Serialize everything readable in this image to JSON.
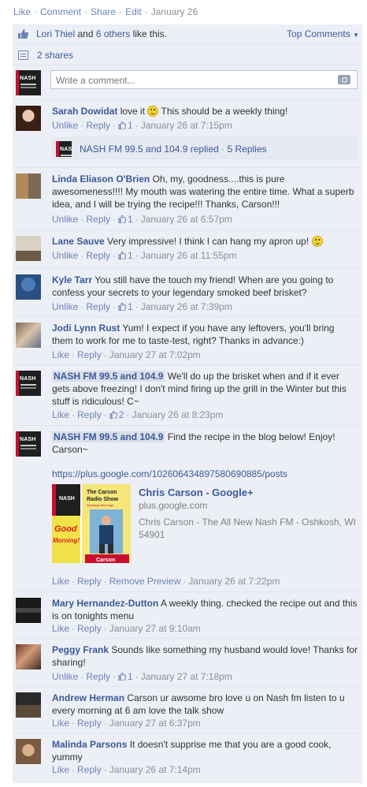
{
  "topbar": {
    "like": "Like",
    "comment": "Comment",
    "share": "Share",
    "edit": "Edit",
    "date": "January 26"
  },
  "likes": {
    "name": "Lori Thiel",
    "and": "and",
    "others": "6 others",
    "suffix": "like this.",
    "top_comments": "Top Comments"
  },
  "shares": {
    "label": "2 shares"
  },
  "write": {
    "placeholder": "Write a comment..."
  },
  "colors": {
    "link": "#3b5998",
    "panel_bg": "#eceff5",
    "meta_gray": "#8b8f98"
  },
  "comments": [
    {
      "author": "Sarah Dowidat",
      "text": "love it",
      "text2": "This should be a weekly thing!",
      "unlike": "Unlike",
      "reply": "Reply",
      "likes": "1",
      "time": "January 26 at 7:15pm",
      "replied": {
        "name": "NASH FM 99.5 and 104.9",
        "replied_label": "replied",
        "replies": "5 Replies"
      }
    },
    {
      "author": "Linda Eliason O'Brien",
      "text": "Oh, my, goodness....this is pure awesomeness!!!! My mouth was watering the entire time. What a superb idea, and I will be trying the recipe!!! Thanks, Carson!!!",
      "unlike": "Unlike",
      "reply": "Reply",
      "likes": "1",
      "time": "January 26 at 6:57pm"
    },
    {
      "author": "Lane Sauve",
      "text": "Very impressive! I think I can hang my apron up!",
      "unlike": "Unlike",
      "reply": "Reply",
      "likes": "1",
      "time": "January 26 at 11:55pm"
    },
    {
      "author": "Kyle Tarr",
      "text": "You still have the touch my friend! When are you going to confess your secrets to your legendary smoked beef brisket?",
      "unlike": "Unlike",
      "reply": "Reply",
      "likes": "1",
      "time": "January 26 at 7:39pm"
    },
    {
      "author": "Jodi Lynn Rust",
      "text": "Yum! I expect if you have any leftovers, you'll bring them to work for me to taste-test, right? Thanks in advance:)",
      "like": "Like",
      "reply": "Reply",
      "time": "January 27 at 7:02pm"
    },
    {
      "author": "NASH FM 99.5 and 104.9",
      "text": "We'll do up the brisket when and if it ever gets above freezing! I don't mind firing up the grill in the Winter but this stuff is ridiculous! C~",
      "like": "Like",
      "reply": "Reply",
      "likes": "2",
      "time": "January 26 at 8:23pm"
    },
    {
      "author": "NASH FM 99.5 and 104.9",
      "text": "Find the recipe in the blog below! Enjoy! Carson~",
      "url": "https://plus.google.com/102606434897580690885/posts",
      "card": {
        "title": "Chris Carson - Google+",
        "host": "plus.google.com",
        "desc": "Chris Carson - The All New Nash FM - Oshkosh, WI 54901",
        "img_nash": "NASH",
        "img_show1": "The Carson",
        "img_show2": "Radio Show",
        "img_show3": "Weekday Mornings",
        "img_good": "Good",
        "img_morning": "Morning!",
        "img_carson": "Carson"
      },
      "like": "Like",
      "reply": "Reply",
      "remove_preview": "Remove Preview",
      "time": "January 26 at 7:22pm"
    },
    {
      "author": "Mary Hernandez-Dutton",
      "text": "A weekly thing. checked the recipe out and this is on tonights menu",
      "like": "Like",
      "reply": "Reply",
      "time": "January 27 at 9:10am"
    },
    {
      "author": "Peggy Frank",
      "text": "Sounds like something my husband would love! Thanks for sharing!",
      "unlike": "Unlike",
      "reply": "Reply",
      "likes": "1",
      "time": "January 27 at 7:18pm"
    },
    {
      "author": "Andrew Herman",
      "text": "Carson ur awsome bro love u on Nash fm listen to u every morning at 6 am love the talk show",
      "like": "Like",
      "reply": "Reply",
      "time": "January 27 at 6:37pm"
    },
    {
      "author": "Malinda Parsons",
      "text": "It doesn't supprise me that you are a good cook, yummy",
      "like": "Like",
      "reply": "Reply",
      "time": "January 26 at 7:14pm"
    }
  ]
}
